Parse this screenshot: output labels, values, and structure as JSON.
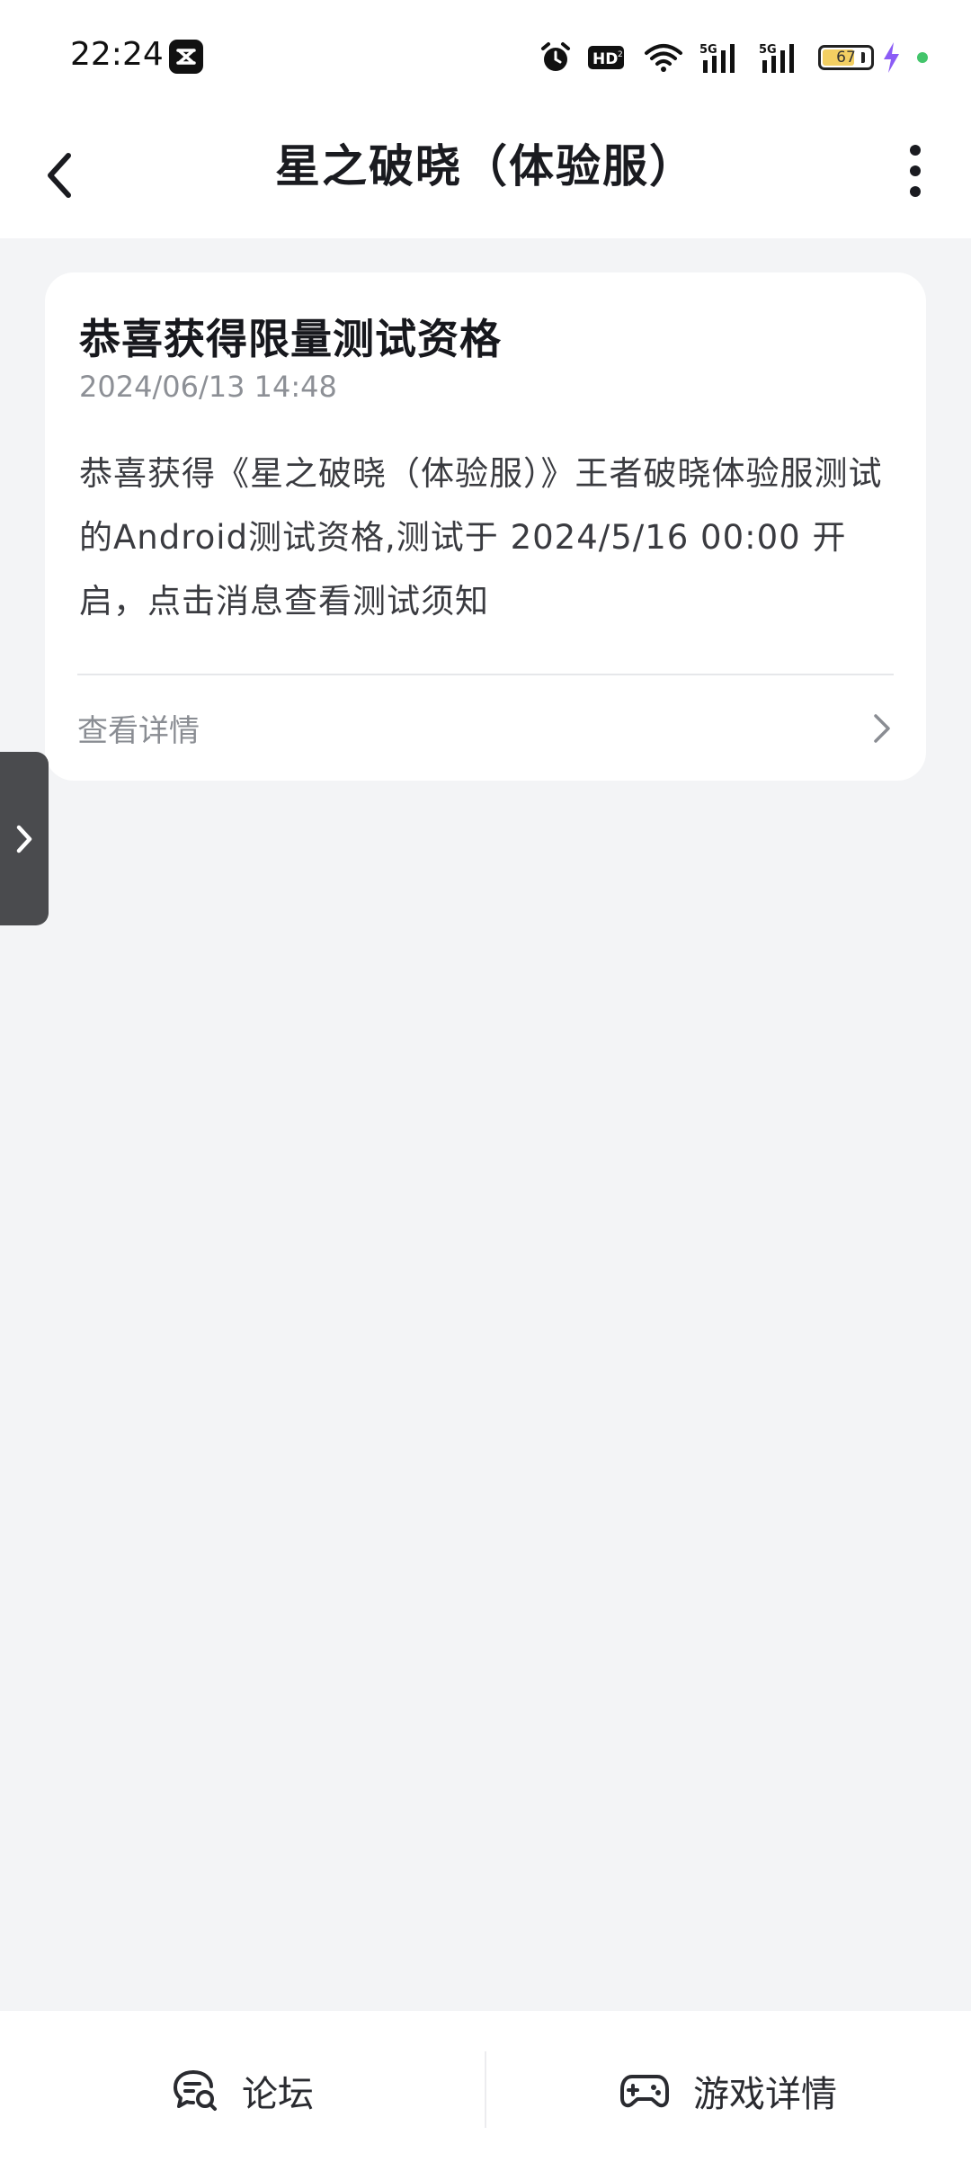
{
  "status_bar": {
    "time": "22:24",
    "icons": [
      "app-badge-icon",
      "alarm-icon",
      "hd-icon",
      "wifi-icon",
      "signal-5g-icon",
      "signal-5g-icon",
      "battery-icon",
      "charging-icon"
    ],
    "battery": "67",
    "battery_level": 0.67
  },
  "header": {
    "title": "星之破晓（体验服）",
    "back_icon": "chevron-left-icon",
    "more_icon": "more-vertical-icon"
  },
  "message": {
    "title": "恭喜获得限量测试资格",
    "timestamp": "2024/06/13 14:48",
    "body": "恭喜获得《星之破晓（体验服）》王者破晓体验服测试的Android测试资格,测试于 2024/5/16 00:00 开启，点击消息查看测试须知",
    "link_label": "查看详情",
    "link_icon": "chevron-right-icon"
  },
  "side_tab": {
    "icon": "chevron-right-icon"
  },
  "bottom_nav": {
    "forum_label": "论坛",
    "forum_icon": "chat-search-icon",
    "game_label": "游戏详情",
    "game_icon": "gamepad-icon"
  },
  "colors": {
    "background": "#f3f4f6",
    "card": "#ffffff",
    "battery_fill": "#f3cf62",
    "charging": "#8b5cf6",
    "status_dot": "#43c56b"
  }
}
